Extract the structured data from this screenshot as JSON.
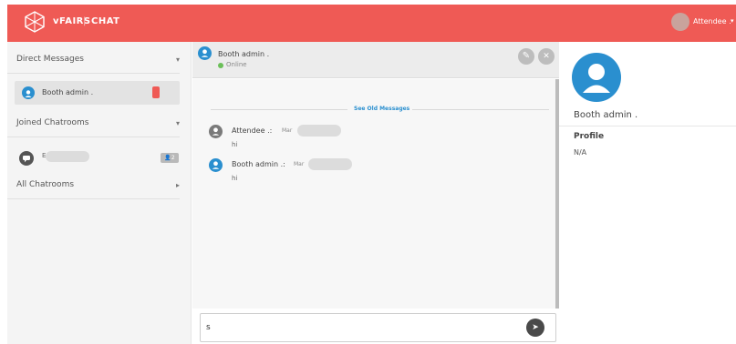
{
  "colors": {
    "brand": "#ef5a55",
    "accent": "#2a8fcf",
    "online": "#6bbf59",
    "sidebar_bg": "#f4f4f4",
    "header_bg": "#ececec"
  },
  "topbar": {
    "logo_icon": "vfairs-logo-icon",
    "brand": "vFAIRS",
    "separator": "|",
    "section": "CHAT",
    "user_name": "Attendee .",
    "user_caret_icon": "chevron-down-icon"
  },
  "sidebar": {
    "direct_messages": {
      "title": "Direct Messages",
      "caret": "▾"
    },
    "dm_items": [
      {
        "name": "Booth admin .",
        "icon": "user-avatar-icon",
        "unread_badge_color": "#ef5a55"
      }
    ],
    "joined_chatrooms": {
      "title": "Joined Chatrooms",
      "caret": "▾"
    },
    "room_items": [
      {
        "prefix": "E",
        "icon": "chat-bubble-icon",
        "count_icon": "users-icon",
        "count": "2"
      }
    ],
    "all_chatrooms": {
      "title": "All Chatrooms",
      "caret": "▸"
    }
  },
  "chat": {
    "header": {
      "name": "Booth admin .",
      "status": "Online",
      "edit_icon": "pencil-icon",
      "close_icon": "close-icon"
    },
    "see_old_messages": "See Old Messages",
    "messages": [
      {
        "author": "Attendee .:",
        "date_prefix": "Mar",
        "text": "hi",
        "avatar_color": "#7a7a7a"
      },
      {
        "author": "Booth admin .:",
        "date_prefix": "Mar",
        "text": "hi",
        "avatar_color": "#2a8fcf"
      }
    ],
    "compose": {
      "value": "s",
      "placeholder": "",
      "send_icon": "send-icon"
    }
  },
  "profile": {
    "name": "Booth admin .",
    "section_label": "Profile",
    "value": "N/A",
    "avatar_icon": "user-avatar-icon"
  }
}
